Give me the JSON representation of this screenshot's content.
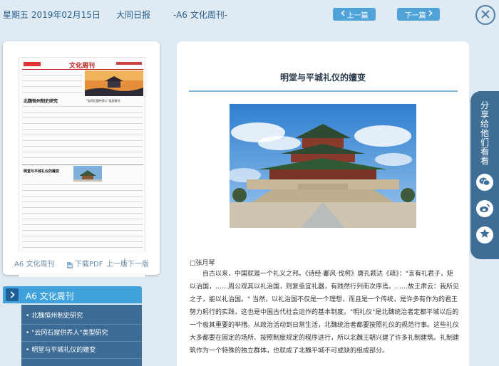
{
  "header": {
    "date": "星期五 2019年02月15日",
    "paper_name": "大同日报",
    "page_label": "-A6 文化周刊-",
    "prev_label": "上一篇",
    "next_label": "下一篇"
  },
  "page_card": {
    "thumbnail": {
      "masthead": "文化周刊",
      "headline": "北魏恒州制史研究",
      "subhead": "\"云冈石窟供养人\"类型研究",
      "secondary_headline": "明堂与平城礼仪的嬗变"
    },
    "page_name": "A6 文化周刊",
    "download_pdf": "下载PDF",
    "prev_page": "上一版",
    "next_page": "下一版"
  },
  "section": {
    "title": "A6  文化周刊",
    "items": [
      "北魏恒州制史研究",
      "\"云冈石窟供养人\"类型研究",
      "明堂与平城礼仪的嬗变"
    ]
  },
  "article": {
    "title": "明堂与平城礼仪的嬗变",
    "byline": "□张月琴",
    "body": "自古以来，中国就是一个礼义之邦。《诗经·鄘风·伐柯》唐孔颖达《疏》：\"言有礼君子，矩以治国，……周公观其以礼治国，则复亟宜礼器，有践然行列而次序焉。……故王肃云：我所见之子，能以礼治国。\" 当然，以礼治国不仅是一个理想，而且是一个传统，是许多有作为的君王努力躬行的实践，这也是中国古代社会运作的基本制度。\"明礼仪\"是北魏统治者定都平城以后的一个极其重要的举措。从政治活动到日常生活，北魏统治者都要按照礼仪的规范行事。这些礼仪大多都要在固定的场所、按照制度规定的程序进行，所以北魏王朝兴建了许多礼制建筑。礼制建筑作为一个特殊的独立群体，也就成了北魏平城不可或缺的组成部分。"
  },
  "share": {
    "label": "分享给他们看看",
    "icons": [
      "wechat-icon",
      "weibo-icon",
      "favorite-icon"
    ]
  },
  "colors": {
    "page_bg": "#dfeaf3",
    "accent": "#4fa3d9",
    "nav_dark": "#3c6c95",
    "rule": "#7cb8dc"
  }
}
